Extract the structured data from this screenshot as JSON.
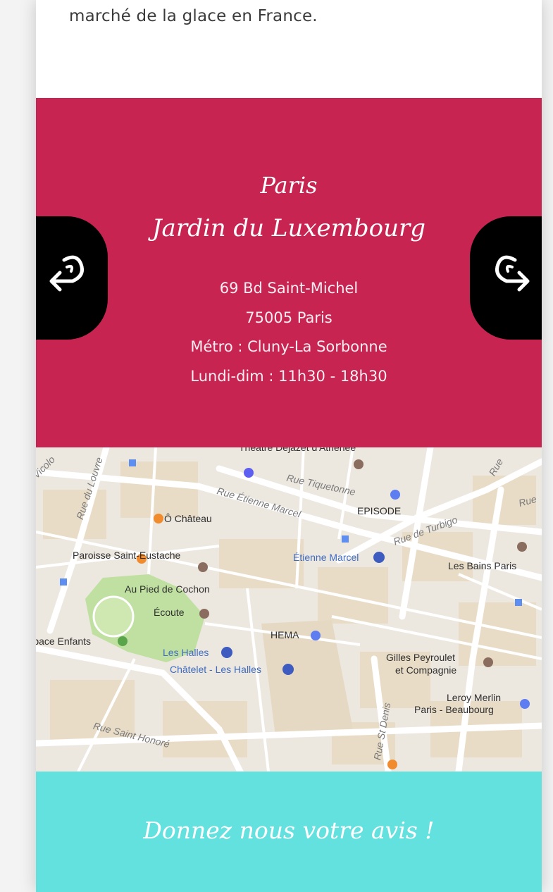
{
  "intro": {
    "text": "marché de la glace en France."
  },
  "shop": {
    "city": "Paris",
    "name": "Jardin du Luxembourg",
    "address": "69 Bd Saint-Michel",
    "postcode": "75005 Paris",
    "metro": "Métro : Cluny-La Sorbonne",
    "hours": "Lundi-dim : 11h30 - 18h30",
    "background_color": "#c82451",
    "prev_icon": "arrow-curved-left-icon",
    "next_icon": "arrow-curved-right-icon"
  },
  "map": {
    "streets": {
      "louvre": "Rue du Louvre",
      "etienne_marcel": "Rue Étienne Marcel",
      "tiquetonne": "Rue Tiquetonne",
      "turbigo": "Rue de Turbigo",
      "saint_honore": "Rue Saint Honoré",
      "saint_denis": "Rue St Denis",
      "top_right": "Rue",
      "top_right2": "Rue",
      "top_left": "Vicolo"
    },
    "places": {
      "theatre": "Théâtre Déjazet d'Athénée",
      "chateau": "Ô Château",
      "episode": "EPISODE",
      "saint_eustache": "Paroisse Saint-Eustache",
      "etienne_marcel_metro": "Étienne Marcel",
      "bains": "Les Bains Paris",
      "pied_de_cochon": "Au Pied de Cochon",
      "ecoute": "Écoute",
      "espace_enfants": "Espace Enfants",
      "halles": "Les Halles",
      "hema": "HEMA",
      "peyroulet": "Gilles Peyroulet",
      "peyroulet2": "et Compagnie",
      "chatelet": "Châtelet - Les Halles",
      "leroy": "Leroy Merlin",
      "leroy2": "Paris - Beaubourg"
    }
  },
  "feedback": {
    "label": "Donnez nous votre avis !",
    "background_color": "#62e1df"
  }
}
